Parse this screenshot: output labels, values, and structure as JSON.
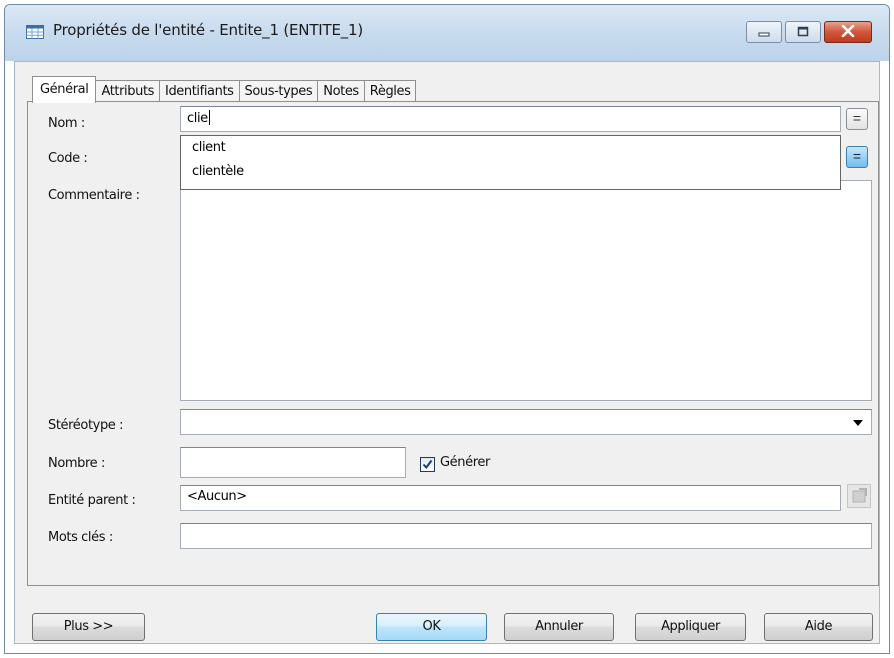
{
  "window": {
    "title": "Propriétés de l'entité - Entite_1 (ENTITE_1)",
    "controls": {
      "minimize": "minimize-icon",
      "maximize": "maximize-icon",
      "close": "close-icon"
    }
  },
  "tabs": [
    {
      "label": "Général",
      "active": true
    },
    {
      "label": "Attributs"
    },
    {
      "label": "Identifiants"
    },
    {
      "label": "Sous-types"
    },
    {
      "label": "Notes"
    },
    {
      "label": "Règles"
    }
  ],
  "form": {
    "name_label": "Nom :",
    "name_value": "clie",
    "code_label": "Code :",
    "comment_label": "Commentaire :",
    "comment_value": "",
    "stereotype_label": "Stéréotype :",
    "stereotype_value": "",
    "number_label": "Nombre :",
    "number_value": "",
    "generate_label": "Générer",
    "generate_checked": true,
    "parent_label": "Entité parent :",
    "parent_value": "<Aucun>",
    "keywords_label": "Mots clés :",
    "keywords_value": "",
    "equal_button": "="
  },
  "autocomplete": {
    "items": [
      "client",
      "clientèle"
    ]
  },
  "buttons": {
    "more": "Plus >>",
    "ok": "OK",
    "cancel": "Annuler",
    "apply": "Appliquer",
    "help": "Aide"
  },
  "colors": {
    "titlebar": "#c9dcee",
    "close_button": "#d0573b",
    "default_button": "#bee6fd",
    "equal_active": "#6fbdee"
  }
}
